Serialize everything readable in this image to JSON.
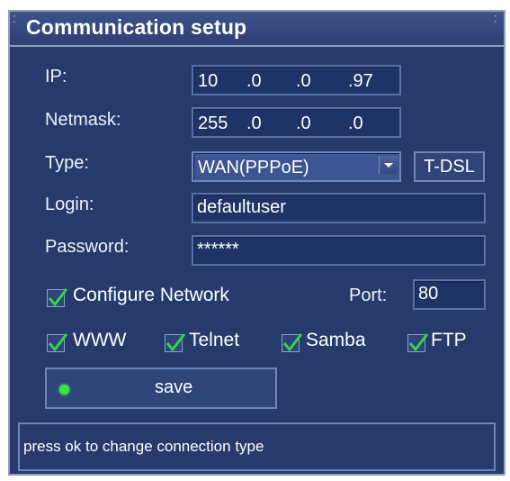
{
  "window": {
    "title": "Communication setup"
  },
  "form": {
    "ip_label": "IP:",
    "ip": [
      "10",
      ".0",
      ".0",
      ".97"
    ],
    "netmask_label": "Netmask:",
    "netmask": [
      "255",
      ".0",
      ".0",
      ".0"
    ],
    "type_label": "Type:",
    "type_value": "WAN(PPPoE)",
    "tdsl_label": "T-DSL",
    "login_label": "Login:",
    "login_value": "defaultuser",
    "password_label": "Password:",
    "password_value": "******",
    "configure_network_label": "Configure Network",
    "configure_network_checked": true,
    "port_label": "Port:",
    "port_value": "80"
  },
  "services": [
    {
      "label": "WWW",
      "checked": true
    },
    {
      "label": "Telnet",
      "checked": true
    },
    {
      "label": "Samba",
      "checked": true
    },
    {
      "label": "FTP",
      "checked": true
    }
  ],
  "save_label": "save",
  "status_text": "press ok to change connection type",
  "colors": {
    "panel": "#263b6b",
    "border": "#8e9fc2",
    "checkmark": "#34d34a",
    "indicator": "#36e83b"
  }
}
